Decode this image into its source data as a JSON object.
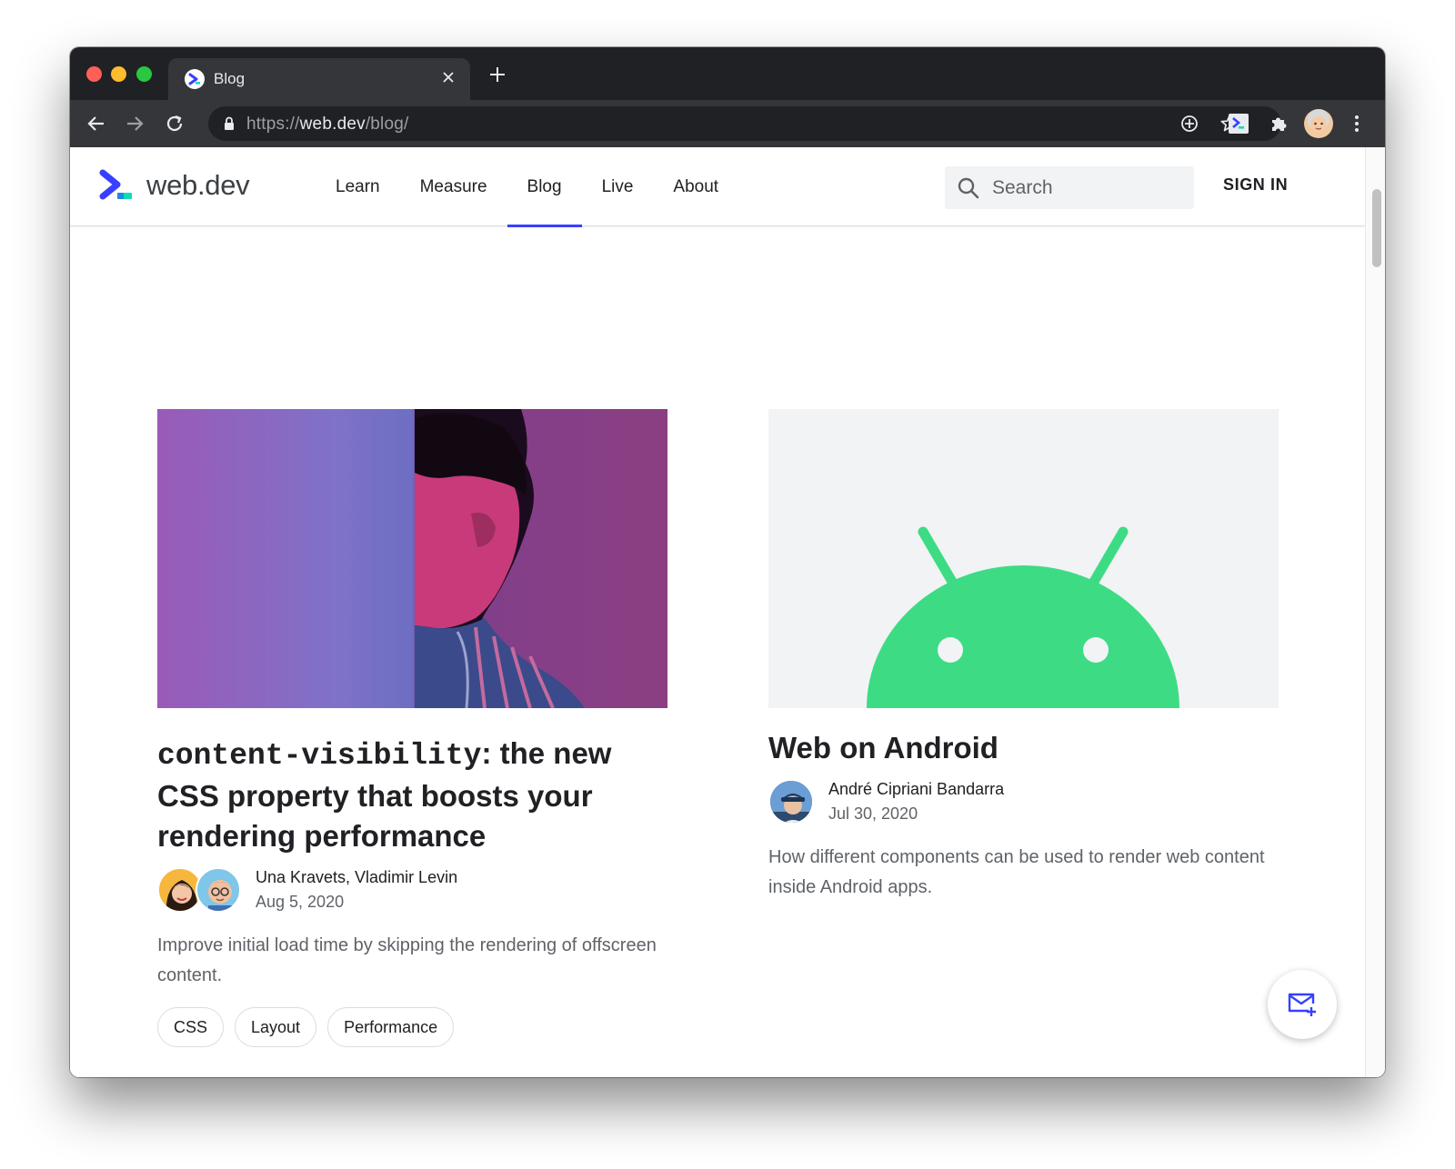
{
  "browser": {
    "tab_title": "Blog",
    "url_scheme": "https://",
    "url_host": "web.dev",
    "url_path": "/blog/"
  },
  "site": {
    "logo_text": "web.dev",
    "nav": [
      {
        "label": "Learn"
      },
      {
        "label": "Measure"
      },
      {
        "label": "Blog",
        "active": true
      },
      {
        "label": "Live"
      },
      {
        "label": "About"
      }
    ],
    "search_placeholder": "Search",
    "signin_label": "SIGN IN",
    "accent_color": "#3740ff"
  },
  "posts": [
    {
      "title_code": "content-visibility",
      "title_rest": ": the new CSS property that boosts your rendering performance",
      "authors": "Una Kravets, Vladimir Levin",
      "date": "Aug 5, 2020",
      "summary": "Improve initial load time by skipping the rendering of offscreen content.",
      "tags": [
        "CSS",
        "Layout",
        "Performance"
      ]
    },
    {
      "title": "Web on Android",
      "authors": "André Cipriani Bandarra",
      "date": "Jul 30, 2020",
      "summary": "How different components can be used to render web content inside Android apps."
    }
  ],
  "icons": {
    "fab": "mail-subscribe-icon",
    "search": "search-icon",
    "lock": "lock-icon"
  }
}
